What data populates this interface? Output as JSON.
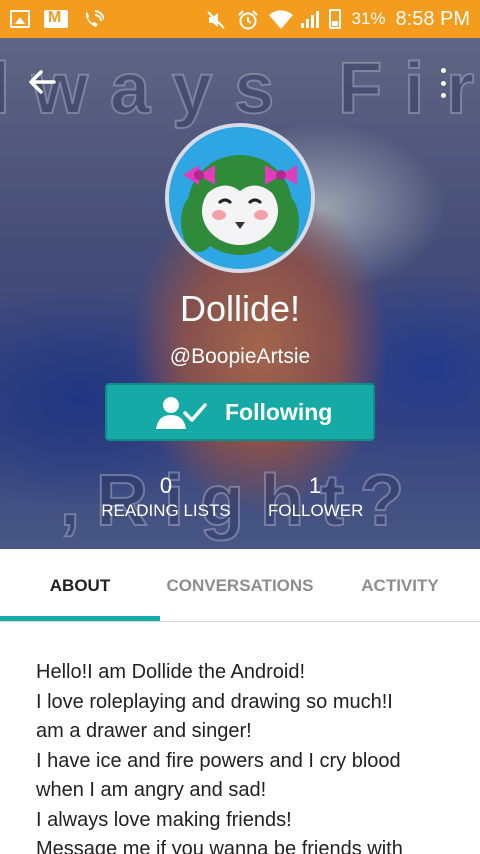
{
  "status_bar": {
    "battery": "31%",
    "time": "8:58 PM"
  },
  "header": {
    "background_words_top": "lways Fir",
    "background_words_bottom": ",Right?",
    "back_icon": "arrow-left-icon",
    "more_icon": "more-vertical-icon"
  },
  "profile": {
    "name": "Dollide!",
    "handle": "@BoopieArtsie",
    "follow_button_label": "Following",
    "stats": [
      {
        "value": "0",
        "label": "READING LISTS"
      },
      {
        "value": "1",
        "label": "FOLLOWER"
      }
    ]
  },
  "tabs": [
    {
      "label": "ABOUT",
      "active": true
    },
    {
      "label": "CONVERSATIONS",
      "active": false
    },
    {
      "label": "ACTIVITY",
      "active": false
    }
  ],
  "about": {
    "lines": [
      "Hello!I am Dollide the Android!",
      "I love roleplaying and drawing so much!I",
      "am a drawer and singer!",
      "I have ice and fire powers and I cry blood",
      "when I am angry and sad!",
      "I always love making friends!",
      "Message me if you wanna be friends with"
    ]
  },
  "colors": {
    "status_bar": "#f39c1e",
    "accent": "#15aaa6"
  }
}
